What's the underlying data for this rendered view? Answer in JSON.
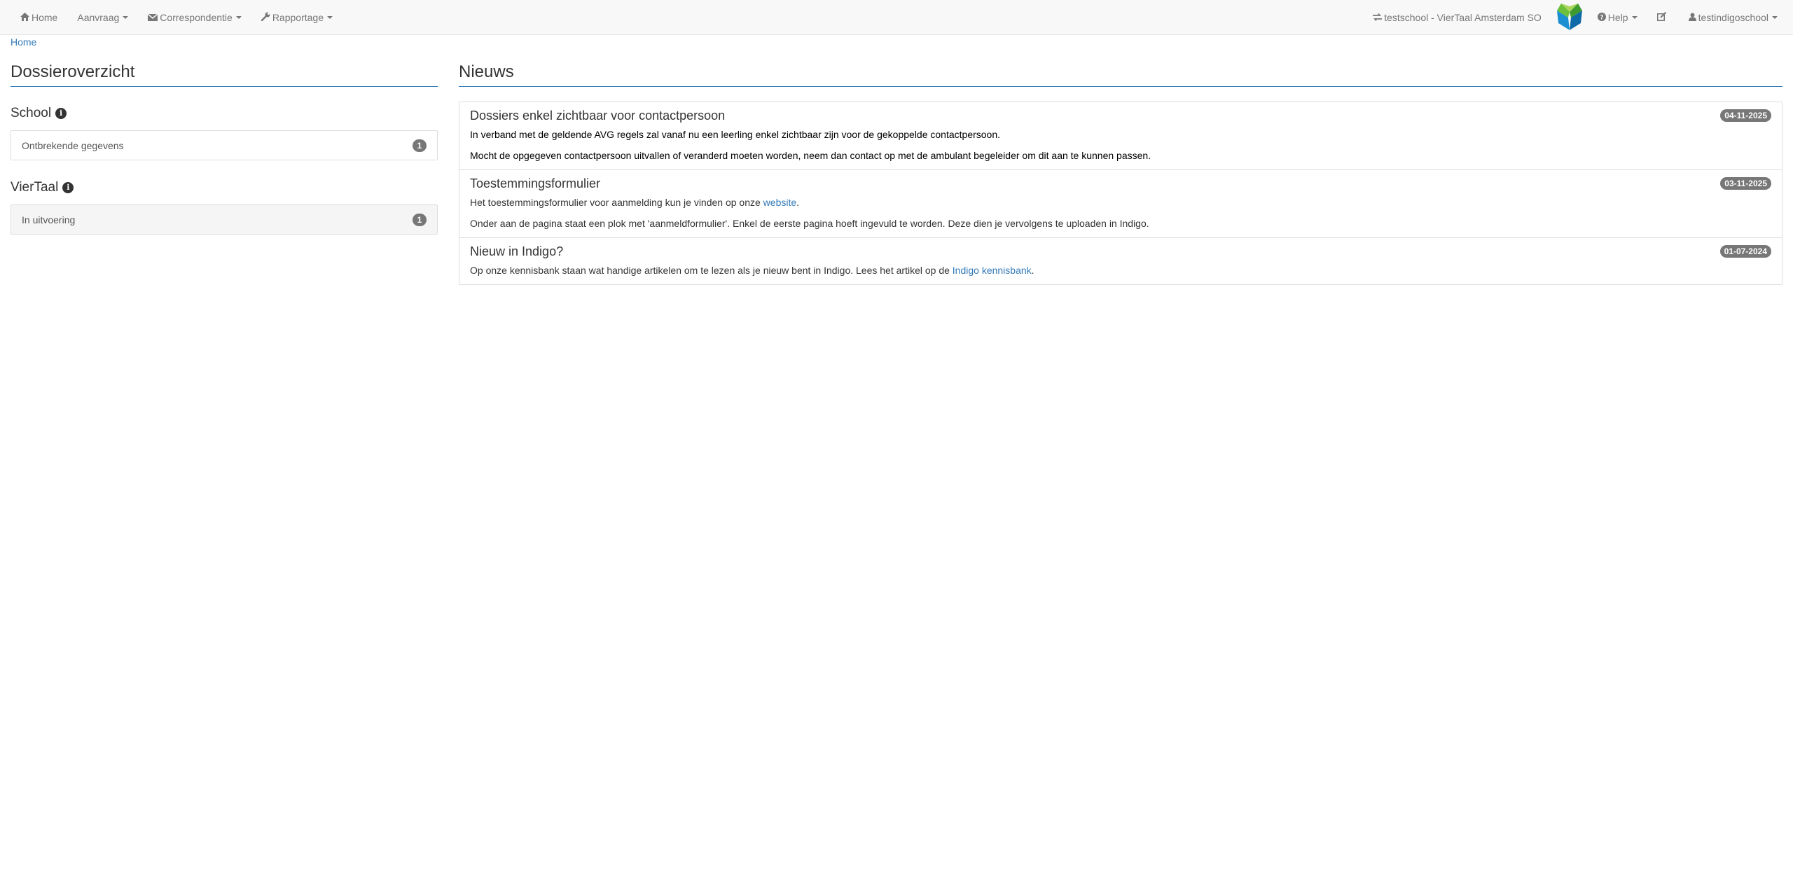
{
  "navbar": {
    "left": [
      {
        "icon": "home-icon",
        "label": "Home",
        "dropdown": false
      },
      {
        "icon": "",
        "label": "Aanvraag",
        "dropdown": true
      },
      {
        "icon": "envelope-icon",
        "label": "Correspondentie",
        "dropdown": true
      },
      {
        "icon": "wrench-icon",
        "label": "Rapportage",
        "dropdown": true
      }
    ],
    "school_switch": {
      "icon": "exchange-icon",
      "label": "testschool - VierTaal Amsterdam SO"
    },
    "logo": "viertaal-leaf-logo",
    "help": {
      "icon": "question-circle-icon",
      "label": "Help"
    },
    "edit_icon": "edit-icon",
    "user": {
      "icon": "user-icon",
      "label": "testindigoschool"
    }
  },
  "breadcrumb": {
    "home": "Home"
  },
  "dossier": {
    "title": "Dossieroverzicht",
    "groups": [
      {
        "title": "School",
        "items": [
          {
            "label": "Ontbrekende gegevens",
            "count": "1"
          }
        ]
      },
      {
        "title": "VierTaal",
        "items": [
          {
            "label": "In uitvoering",
            "count": "1"
          }
        ]
      }
    ]
  },
  "news": {
    "title": "Nieuws",
    "items": [
      {
        "title": "Dossiers enkel zichtbaar voor contactpersoon",
        "date": "04-11-2025",
        "p1": "In verband met de geldende AVG regels zal vanaf nu een leerling enkel zichtbaar zijn voor de gekoppelde contactpersoon.",
        "p2": "Mocht de opgegeven contactpersoon uitvallen of veranderd moeten worden, neem dan contact op met de ambulant begeleider om dit aan te kunnen passen."
      },
      {
        "title": "Toestemmingsformulier",
        "date": "03-11-2025",
        "p1_before": "Het toestemmingsformulier voor aanmelding kun je vinden op onze ",
        "p1_link": "website",
        "p1_after": ".",
        "p2": "Onder aan de pagina staat een plok met 'aanmeldformulier'. Enkel de eerste pagina hoeft ingevuld te worden. Deze dien je vervolgens te uploaden in Indigo."
      },
      {
        "title": "Nieuw in Indigo?",
        "date": "01-07-2024",
        "p1_before": "Op onze kennisbank staan wat handige artikelen om te lezen als je nieuw bent in Indigo. Lees het artikel op de ",
        "p1_link": "Indigo kennisbank",
        "p1_after": "."
      }
    ]
  },
  "colors": {
    "navbar_bg": "#f8f8f8",
    "link": "#337ab7",
    "badge": "#777777",
    "divider": "#337ab7"
  }
}
